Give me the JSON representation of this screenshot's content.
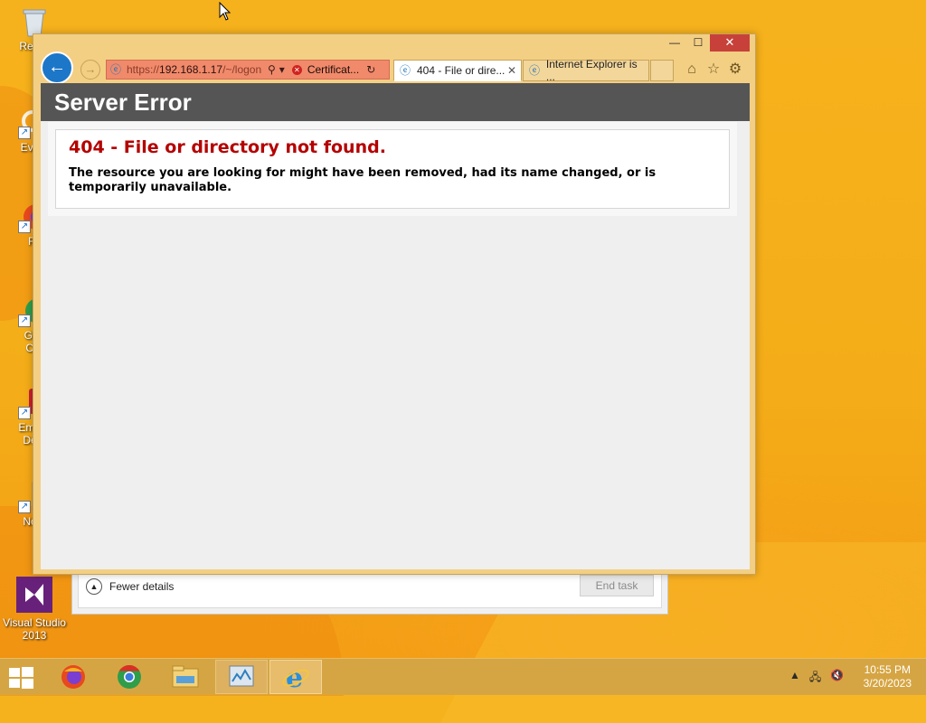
{
  "desktop": {
    "icons": [
      {
        "label": "Recycle Bin",
        "shown": "Recyc",
        "icon": "recycle-bin-icon"
      },
      {
        "label": "Everything",
        "shown": "Every",
        "icon": "everything-icon"
      },
      {
        "label": "Firefox",
        "shown": "Fir",
        "icon": "firefox-icon"
      },
      {
        "label": "Google Chrome",
        "shown": "Goo Chr",
        "icon": "chrome-icon"
      },
      {
        "label": "Embarcadero Dev-C++",
        "shown": "Emba Dev",
        "icon": "devcpp-icon"
      },
      {
        "label": "Notepad++",
        "shown": "Note",
        "icon": "notepad-icon"
      },
      {
        "label": "Visual Studio 2013",
        "shown_line1": "Visual Studio",
        "shown_line2": "2013",
        "icon": "visual-studio-icon"
      }
    ]
  },
  "task_manager": {
    "fewer_details": "Fewer details",
    "end_task": "End task"
  },
  "browser": {
    "window_controls": {
      "minimize": "—",
      "maximize": "☐",
      "close": "✕"
    },
    "address": {
      "url_prefix": "https://",
      "url_host": "192.168.1.17",
      "url_path": "/~/logon",
      "certificate_text": "Certificat...",
      "search_glyph": "⚲",
      "dropdown_glyph": "▾",
      "refresh_glyph": "↻"
    },
    "tabs": [
      {
        "title": "404 - File or dire...",
        "active": true
      },
      {
        "title": "Internet Explorer is ...",
        "active": false
      }
    ],
    "tools": {
      "home": "⌂",
      "favorites": "☆",
      "settings": "⚙"
    },
    "page": {
      "header": "Server Error",
      "error_title": "404 - File or directory not found.",
      "error_message": "The resource you are looking for might have been removed, had its name changed, or is temporarily unavailable."
    }
  },
  "taskbar": {
    "apps": [
      "firefox-icon",
      "chrome-icon",
      "file-explorer-icon",
      "task-manager-icon",
      "internet-explorer-icon"
    ],
    "active_app": "internet-explorer-icon",
    "clock": {
      "time": "10:55 PM",
      "date": "3/20/2023"
    }
  },
  "colors": {
    "desktop_bg": "#f4ad18",
    "error_red": "#b40000",
    "header_gray": "#555555",
    "address_error": "#f08a6a"
  }
}
